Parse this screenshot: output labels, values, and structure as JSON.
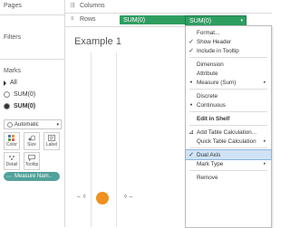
{
  "left_panel": {
    "pages_title": "Pages",
    "filters_title": "Filters",
    "marks_title": "Marks",
    "marks_items": [
      {
        "label": "All"
      },
      {
        "label": "SUM(0)"
      },
      {
        "label": "SUM(0)"
      }
    ],
    "mark_type": "Automatic",
    "tiles_row1": [
      {
        "label": "Color"
      },
      {
        "label": "Size"
      },
      {
        "label": "Label"
      }
    ],
    "tiles_row2": [
      {
        "label": "Detail"
      },
      {
        "label": "Tooltip"
      }
    ],
    "measure_pill": "Measure Nam.."
  },
  "shelves": {
    "columns_label": "Columns",
    "rows_label": "Rows",
    "row_pills": [
      "SUM(0)",
      "SUM(0)"
    ]
  },
  "view": {
    "title": "Example 1"
  },
  "context_menu": {
    "items": [
      {
        "label": "Format...",
        "checked": false,
        "submenu": false
      },
      {
        "label": "Show Header",
        "checked": true,
        "submenu": false
      },
      {
        "label": "Include in Tooltip",
        "checked": true,
        "submenu": false
      },
      {
        "label": "Dimension",
        "checked": false,
        "submenu": false
      },
      {
        "label": "Attribute",
        "checked": false,
        "submenu": false
      },
      {
        "label": "Measure (Sum)",
        "checked": true,
        "submenu": true
      },
      {
        "label": "Discrete",
        "checked": false,
        "submenu": false
      },
      {
        "label": "Continuous",
        "checked": true,
        "submenu": false
      },
      {
        "label": "Edit in Shelf",
        "checked": false,
        "submenu": false
      },
      {
        "label": "Add Table Calculation...",
        "checked": false,
        "submenu": false
      },
      {
        "label": "Quick Table Calculation",
        "checked": false,
        "submenu": true
      },
      {
        "label": "Dual Axis",
        "checked": true,
        "submenu": false
      },
      {
        "label": "Mark Type",
        "checked": false,
        "submenu": true
      },
      {
        "label": "Remove",
        "checked": false,
        "submenu": false
      }
    ],
    "check_glyph": "✓",
    "arrow_glyph": "▸"
  },
  "colors": {
    "green_pill": "#2e9e60",
    "teal_pill": "#52a29a",
    "mark_orange": "#f0901e",
    "highlight": "#cfe3f5"
  }
}
